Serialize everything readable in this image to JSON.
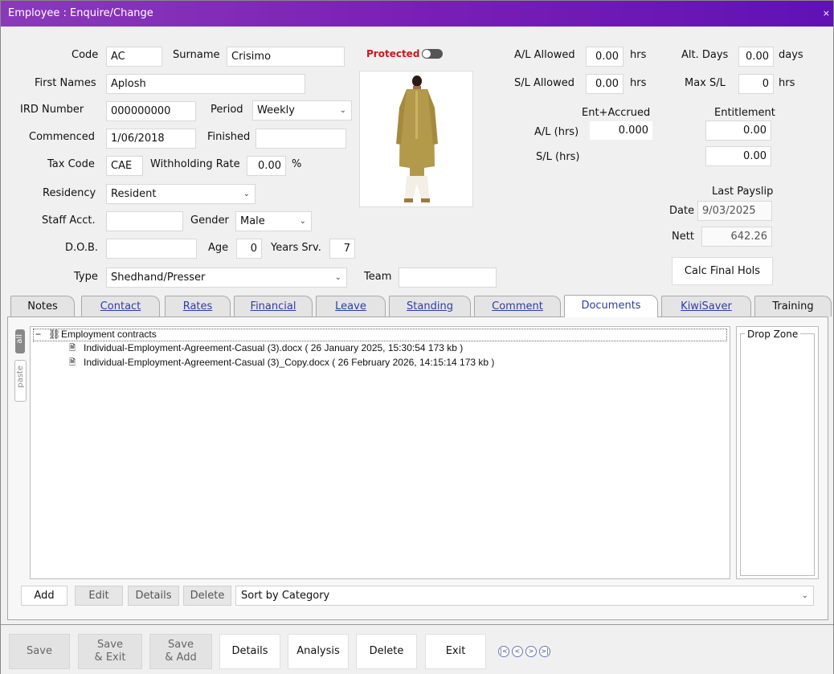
{
  "window": {
    "title": "Employee : Enquire/Change",
    "close": "×"
  },
  "form": {
    "code_label": "Code",
    "code": "AC",
    "surname_label": "Surname",
    "surname": "Crisimo",
    "protected_label": "Protected",
    "first_names_label": "First Names",
    "first_names": "Aplosh",
    "ird_label": "IRD Number",
    "ird": "000000000",
    "period_label": "Period",
    "period": "Weekly",
    "commenced_label": "Commenced",
    "commenced": "1/06/2018",
    "finished_label": "Finished",
    "finished": "",
    "tax_code_label": "Tax Code",
    "tax_code": "CAE",
    "withholding_label": "Withholding Rate",
    "withholding": "0.00",
    "percent": "%",
    "residency_label": "Residency",
    "residency": "Resident",
    "staff_acct_label": "Staff Acct.",
    "staff_acct": "",
    "gender_label": "Gender",
    "gender": "Male",
    "dob_label": "D.O.B.",
    "dob": "",
    "age_label": "Age",
    "age": "0",
    "years_srv_label": "Years Srv.",
    "years_srv": "7",
    "type_label": "Type",
    "type": "Shedhand/Presser",
    "team_label": "Team",
    "team": ""
  },
  "leave": {
    "al_allowed_label": "A/L Allowed",
    "al_allowed": "0.00",
    "hrs": "hrs",
    "sl_allowed_label": "S/L Allowed",
    "sl_allowed": "0.00",
    "alt_days_label": "Alt. Days",
    "alt_days": "0.00",
    "days": "days",
    "max_sl_label": "Max S/L",
    "max_sl": "0",
    "ent_accrued_label": "Ent+Accrued",
    "entitlement_label": "Entitlement",
    "al_hrs_label": "A/L (hrs)",
    "al_ent_accrued": "0.000",
    "al_entitlement": "0.00",
    "sl_hrs_label": "S/L (hrs)",
    "sl_ent_accrued": "",
    "sl_entitlement": "0.00"
  },
  "payslip": {
    "heading": "Last Payslip",
    "date_label": "Date",
    "date": "9/03/2025",
    "nett_label": "Nett",
    "nett": "642.26",
    "calc_final_hols": "Calc Final Hols"
  },
  "tabs": [
    "Notes",
    "Contact",
    "Rates",
    "Financial",
    "Leave",
    "Standing",
    "Comment",
    "Documents",
    "KiwiSaver",
    "Training"
  ],
  "active_tab": "Documents",
  "side_tabs": {
    "all": "all",
    "paste": "paste"
  },
  "documents": {
    "group": "Employment contracts",
    "items": [
      "Individual-Employment-Agreement-Casual (3).docx   ( 26 January 2025, 15:30:54  173 kb )",
      "Individual-Employment-Agreement-Casual (3)_Copy.docx   ( 26 February 2026, 14:15:14  173 kb )"
    ],
    "drop_zone": "Drop Zone"
  },
  "doc_buttons": {
    "add": "Add",
    "edit": "Edit",
    "details": "Details",
    "delete": "Delete",
    "sort": "Sort by Category"
  },
  "bottom_buttons": {
    "save": "Save",
    "save_exit_1": "Save",
    "save_exit_2": "& Exit",
    "save_add_1": "Save",
    "save_add_2": "& Add",
    "details": "Details",
    "analysis": "Analysis",
    "delete": "Delete",
    "exit": "Exit"
  },
  "nav_icons": [
    "first-record-icon",
    "prev-record-icon",
    "next-record-icon",
    "last-record-icon"
  ],
  "colors": {
    "title_start": "#8a3ab9",
    "title_end": "#5f12b5",
    "protected": "#d0161b",
    "tab_link": "#2a3ea6"
  }
}
